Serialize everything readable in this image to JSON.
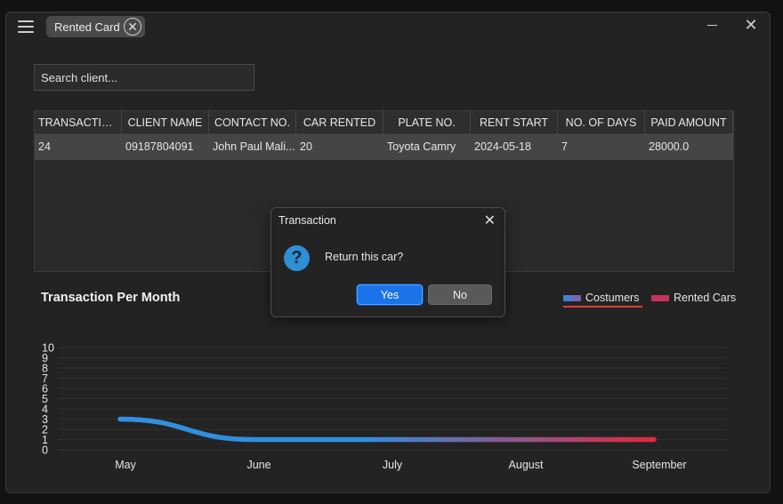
{
  "window": {
    "tab_label": "Rented Card",
    "tab_close_glyph": "✕",
    "close_glyph": "✕"
  },
  "search": {
    "placeholder": "Search client..."
  },
  "table": {
    "columns": [
      "TRANSACTIO...",
      "CLIENT NAME",
      "CONTACT NO.",
      "CAR RENTED",
      "PLATE  NO.",
      "RENT START",
      "NO. OF DAYS",
      "PAID AMOUNT"
    ],
    "rows": [
      [
        "24",
        "09187804091",
        "John Paul Mali...",
        "20",
        "Toyota Camry",
        "2024-05-18",
        "7",
        "28000.0"
      ]
    ]
  },
  "chart_title": "Transaction Per Month",
  "legend": {
    "costumers": "Costumers",
    "rented_cars": "Rented Cars",
    "costumers_color": "#3a86d4",
    "rented_color": "#c9305a"
  },
  "dialog": {
    "title": "Transaction",
    "close_glyph": "✕",
    "icon": "?",
    "message": "Return this car?",
    "yes_label": "Yes",
    "no_label": "No"
  },
  "chart_data": {
    "type": "line",
    "categories": [
      "May",
      "June",
      "July",
      "August",
      "September"
    ],
    "series": [
      {
        "name": "Costumers",
        "values": [
          3,
          1,
          1,
          1,
          1
        ]
      }
    ],
    "yticks": [
      0,
      1,
      2,
      3,
      4,
      5,
      6,
      7,
      8,
      9,
      10
    ],
    "ylim": [
      0,
      10
    ],
    "grid": true,
    "legend": "top-right",
    "colors": {
      "start": "#2f8fe0",
      "end": "#e0273f"
    }
  }
}
